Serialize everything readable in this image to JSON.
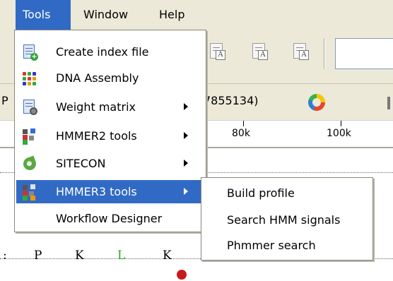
{
  "menubar": {
    "tools": "Tools",
    "window": "Window",
    "help": "Help"
  },
  "toolbar": {
    "icon_overlay_letter": "A"
  },
  "sequence_header": {
    "left_fragment": "P",
    "id_fragment": "7855134)"
  },
  "ruler": {
    "labels": [
      "80k",
      "100k"
    ]
  },
  "sequence": {
    "row1": [
      "P",
      "K",
      "L",
      "K"
    ],
    "row1_highlight_color": "#22aa22"
  },
  "tools_menu": {
    "items": [
      {
        "label": "Create index file",
        "icon": "create-index-icon",
        "submenu": false
      },
      {
        "label": "DNA Assembly",
        "icon": "dna-assembly-icon",
        "submenu": false
      },
      {
        "label": "Weight matrix",
        "icon": "weight-matrix-icon",
        "submenu": true
      },
      {
        "label": "HMMER2 tools",
        "icon": "hmmer2-icon",
        "submenu": true
      },
      {
        "label": "SITECON",
        "icon": "sitecon-icon",
        "submenu": true
      },
      {
        "label": "HMMER3 tools",
        "icon": "hmmer3-icon",
        "submenu": true,
        "highlighted": true
      },
      {
        "label": "Workflow Designer",
        "icon": "",
        "submenu": false
      }
    ]
  },
  "hmmer3_submenu": {
    "items": [
      "Build profile",
      "Search HMM signals",
      "Phmmer search"
    ]
  },
  "colors": {
    "menu_highlight": "#316ac5",
    "chrome": "#ece9d8"
  }
}
